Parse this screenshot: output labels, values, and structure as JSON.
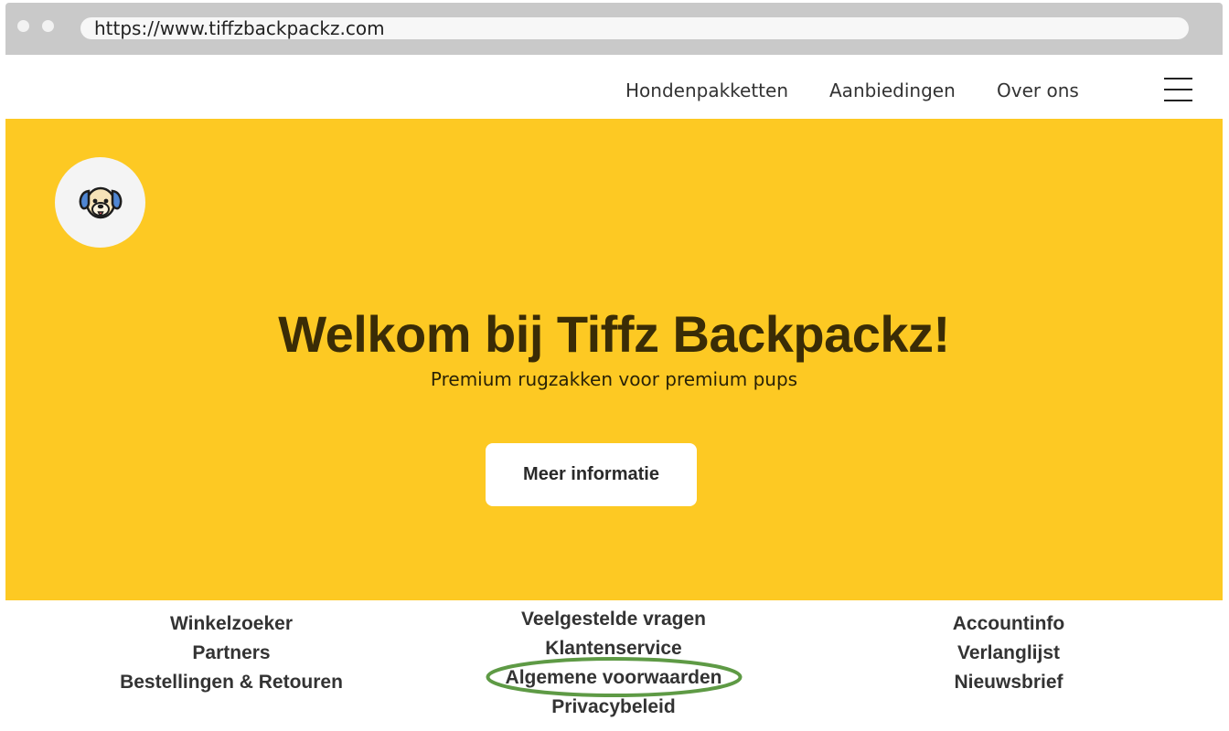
{
  "browser": {
    "url": "https://www.tiffzbackpackz.com"
  },
  "nav": {
    "items": [
      {
        "label": "Hondenpakketten"
      },
      {
        "label": "Aanbiedingen"
      },
      {
        "label": "Over ons"
      }
    ],
    "menu_icon": "hamburger-menu-icon"
  },
  "hero": {
    "logo_icon": "dog-face-icon",
    "title": "Welkom bij Tiffz Backpackz!",
    "subtitle": "Premium rugzakken voor premium pups",
    "button_label": "Meer informatie",
    "background_color": "#fdc923"
  },
  "footer": {
    "left": [
      "Winkelzoeker",
      "Partners",
      "Bestellingen & Retouren"
    ],
    "middle": [
      "Veelgestelde vragen",
      "Klantenservice",
      "Algemene voorwaarden",
      "Privacybeleid"
    ],
    "right": [
      "Accountinfo",
      "Verlanglijst",
      "Nieuwsbrief"
    ],
    "highlight_color": "#5e9a45"
  }
}
